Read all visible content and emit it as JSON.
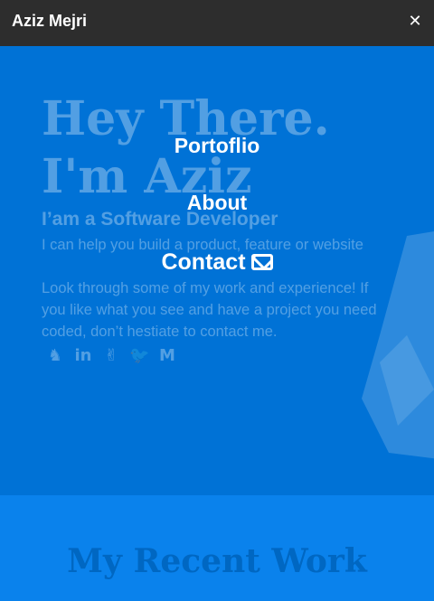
{
  "navbar": {
    "brand": "Aziz Mejri",
    "close_glyph": "✕"
  },
  "hero": {
    "line1": "Hey There.",
    "line2": "I'm Aziz",
    "role": "I’am a Software Developer",
    "para1": "I can help you build a product, feature or website",
    "para2": "Look through some of my work and experience! If you like what you see and have a project you need coded, don’t hestiate to contact me.",
    "socials": [
      {
        "icon": "github-icon",
        "glyph": "♞"
      },
      {
        "icon": "linkedin-icon",
        "glyph": "in"
      },
      {
        "icon": "angellist-icon",
        "glyph": "✌"
      },
      {
        "icon": "twitter-icon",
        "glyph": "🐦"
      },
      {
        "icon": "medium-icon",
        "glyph": "M"
      }
    ]
  },
  "menu": {
    "items": [
      {
        "label": "Portoflio"
      },
      {
        "label": "About"
      },
      {
        "label": "Contact",
        "icon": "envelope-icon"
      }
    ]
  },
  "recent": {
    "title": "My Recent Work"
  },
  "colors": {
    "navbar": "#2d2d2d",
    "hero": "#0072d6",
    "recent": "#0a82ec"
  }
}
